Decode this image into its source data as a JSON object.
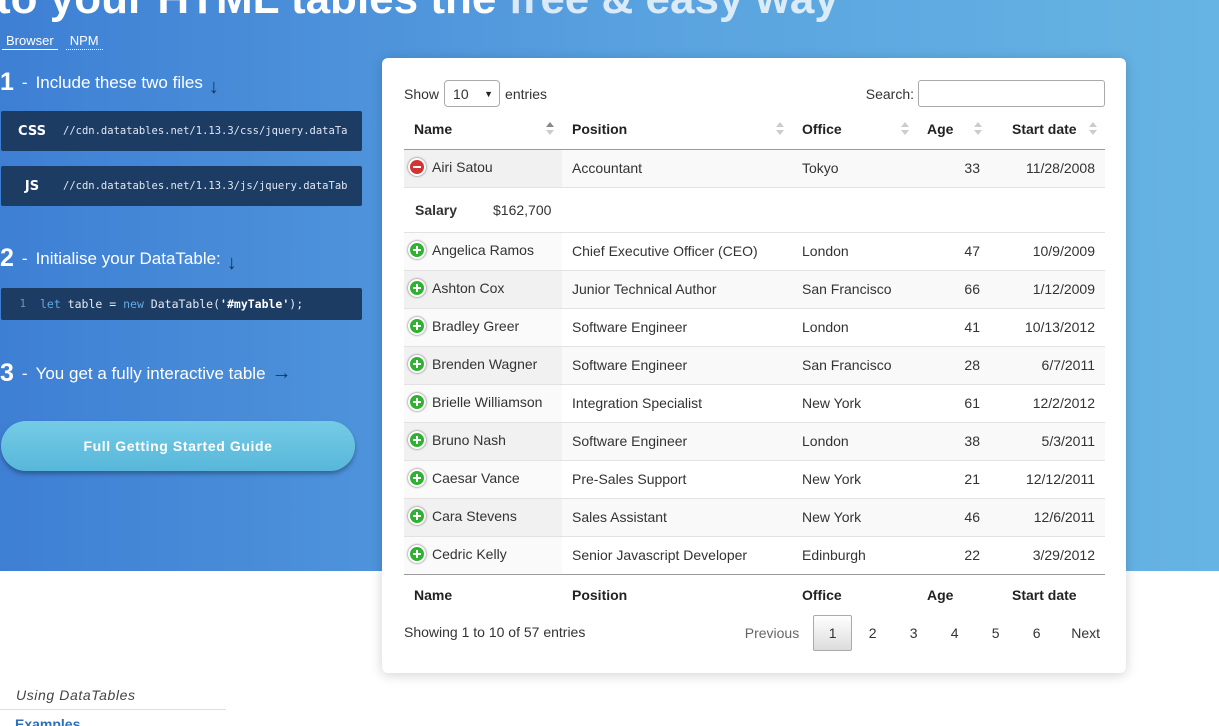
{
  "hero": {
    "title_bold": "to your HTML tables the ",
    "title_light": "free & easy way",
    "tabs": [
      "Browser",
      "NPM"
    ],
    "step1": {
      "num": "1",
      "dash": "-",
      "text": "Include these two files",
      "arrow": "↓"
    },
    "css_code": {
      "lang": "CSS",
      "url": "//cdn.datatables.net/1.13.3/css/jquery.dataTa"
    },
    "js_code": {
      "lang": "JS",
      "url": "//cdn.datatables.net/1.13.3/js/jquery.dataTab"
    },
    "step2": {
      "num": "2",
      "dash": "-",
      "text": "Initialise your DataTable:",
      "arrow": "↓"
    },
    "init_code": {
      "line": "1",
      "kw1": "let",
      "mid1": " table = ",
      "kw2": "new",
      "mid2": " DataTable(",
      "str": "'#myTable'",
      "end": ");"
    },
    "step3": {
      "num": "3",
      "dash": "-",
      "text": "You get a fully interactive table",
      "arrow": "→"
    },
    "guide_button": "Full Getting Started Guide"
  },
  "nav": {
    "section_label": "Using DataTables",
    "link": "Examples"
  },
  "table": {
    "length_label_before": "Show",
    "length_value": "10",
    "length_label_after": "entries",
    "search_label": "Search:",
    "search_value": "",
    "columns": [
      "Name",
      "Position",
      "Office",
      "Age",
      "Start date"
    ],
    "rows": [
      {
        "name": "Airi Satou",
        "position": "Accountant",
        "office": "Tokyo",
        "age": "33",
        "start": "11/28/2008",
        "expanded": true
      },
      {
        "name": "Angelica Ramos",
        "position": "Chief Executive Officer (CEO)",
        "office": "London",
        "age": "47",
        "start": "10/9/2009"
      },
      {
        "name": "Ashton Cox",
        "position": "Junior Technical Author",
        "office": "San Francisco",
        "age": "66",
        "start": "1/12/2009"
      },
      {
        "name": "Bradley Greer",
        "position": "Software Engineer",
        "office": "London",
        "age": "41",
        "start": "10/13/2012"
      },
      {
        "name": "Brenden Wagner",
        "position": "Software Engineer",
        "office": "San Francisco",
        "age": "28",
        "start": "6/7/2011"
      },
      {
        "name": "Brielle Williamson",
        "position": "Integration Specialist",
        "office": "New York",
        "age": "61",
        "start": "12/2/2012"
      },
      {
        "name": "Bruno Nash",
        "position": "Software Engineer",
        "office": "London",
        "age": "38",
        "start": "5/3/2011"
      },
      {
        "name": "Caesar Vance",
        "position": "Pre-Sales Support",
        "office": "New York",
        "age": "21",
        "start": "12/12/2011"
      },
      {
        "name": "Cara Stevens",
        "position": "Sales Assistant",
        "office": "New York",
        "age": "46",
        "start": "12/6/2011"
      },
      {
        "name": "Cedric Kelly",
        "position": "Senior Javascript Developer",
        "office": "Edinburgh",
        "age": "22",
        "start": "3/29/2012"
      }
    ],
    "child": {
      "label": "Salary",
      "value": "$162,700"
    },
    "info": "Showing 1 to 10 of 57 entries",
    "pager": {
      "previous": "Previous",
      "pages": [
        "1",
        "2",
        "3",
        "4",
        "5",
        "6"
      ],
      "current": "1",
      "next": "Next"
    }
  }
}
